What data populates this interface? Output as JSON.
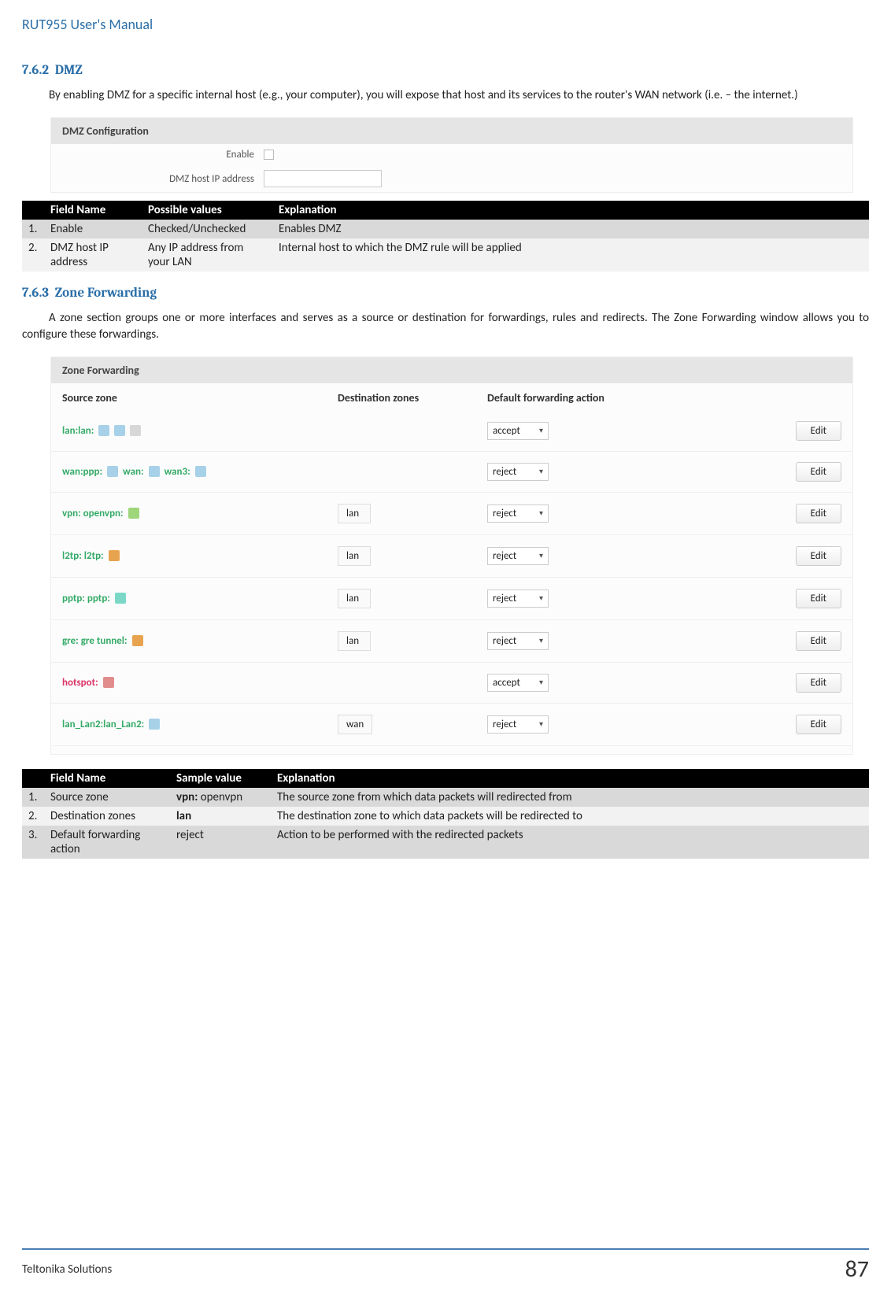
{
  "doc": {
    "title": "RUT955 User's Manual",
    "footer_left": "Teltonika Solutions",
    "page_number": "87"
  },
  "section1": {
    "num": "7.6.2",
    "title": "DMZ",
    "para": "By enabling DMZ for a specific internal host (e.g., your computer), you will expose that host and its services to the router's WAN network (i.e. – the internet.)"
  },
  "dmz_ui": {
    "header": "DMZ Configuration",
    "label_enable": "Enable",
    "label_ip": "DMZ host IP address"
  },
  "table1": {
    "headers": [
      "",
      "Field Name",
      "Possible values",
      "Explanation"
    ],
    "rows": [
      {
        "n": "1.",
        "field": "Enable",
        "val": "Checked/Unchecked",
        "exp": "Enables DMZ"
      },
      {
        "n": "2.",
        "field": "DMZ host IP address",
        "val": "Any IP address from your LAN",
        "exp": "Internal host to which the DMZ rule will be applied"
      }
    ]
  },
  "section2": {
    "num": "7.6.3",
    "title": "Zone Forwarding",
    "para": "A zone section groups one or more interfaces and serves as a source or destination for forwardings, rules and redirects. The Zone Forwarding window allows you to configure these forwardings."
  },
  "zf_ui": {
    "header": "Zone Forwarding",
    "col_src": "Source zone",
    "col_dst": "Destination zones",
    "col_fwd": "Default forwarding action",
    "edit_label": "Edit",
    "rows": [
      {
        "src_label": "lan:lan:",
        "dst": "",
        "fwd": "accept"
      },
      {
        "src_label": "wan:ppp:",
        "extra1": "wan:",
        "extra2": "wan3:",
        "dst": "",
        "fwd": "reject"
      },
      {
        "src_label": "vpn: openvpn:",
        "dst": "lan",
        "fwd": "reject"
      },
      {
        "src_label": "l2tp: l2tp:",
        "dst": "lan",
        "fwd": "reject"
      },
      {
        "src_label": "pptp: pptp:",
        "dst": "lan",
        "fwd": "reject"
      },
      {
        "src_label": "gre: gre tunnel:",
        "dst": "lan",
        "fwd": "reject"
      },
      {
        "src_label": "hotspot:",
        "dst": "",
        "fwd": "accept"
      },
      {
        "src_label": "lan_Lan2:lan_Lan2:",
        "dst": "wan",
        "fwd": "reject"
      }
    ]
  },
  "table2": {
    "headers": [
      "",
      "Field Name",
      "Sample value",
      "Explanation"
    ],
    "rows": [
      {
        "n": "1.",
        "field": "Source zone",
        "val_bold": "vpn:",
        "val_rest": " openvpn",
        "exp": "The source zone from which data packets will redirected from"
      },
      {
        "n": "2.",
        "field": "Destination zones",
        "val_bold": "lan",
        "val_rest": "",
        "exp": "The destination zone to which data packets will be redirected to"
      },
      {
        "n": "3.",
        "field": "Default forwarding action",
        "val_bold": "",
        "val_rest": "reject",
        "exp": "Action to be performed with the redirected packets"
      }
    ]
  }
}
